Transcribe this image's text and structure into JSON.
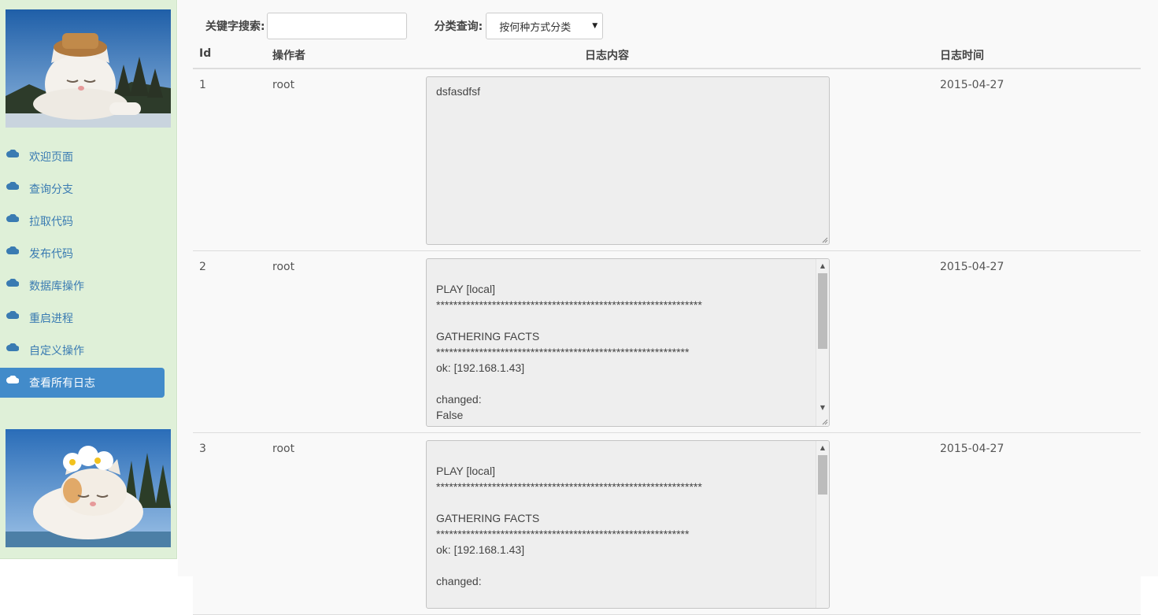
{
  "sidebar": {
    "items": [
      {
        "label": "欢迎页面",
        "icon": "cloud-icon",
        "active": false
      },
      {
        "label": "查询分支",
        "icon": "cloud-icon",
        "active": false
      },
      {
        "label": "拉取代码",
        "icon": "cloud-icon",
        "active": false
      },
      {
        "label": "发布代码",
        "icon": "cloud-icon",
        "active": false
      },
      {
        "label": "数据库操作",
        "icon": "cloud-icon",
        "active": false
      },
      {
        "label": "重启进程",
        "icon": "cloud-icon",
        "active": false
      },
      {
        "label": "自定义操作",
        "icon": "cloud-icon",
        "active": false
      },
      {
        "label": "查看所有日志",
        "icon": "cloud-icon",
        "active": true
      }
    ]
  },
  "search": {
    "keyword_label": "关键字搜索:",
    "keyword_value": "",
    "category_label": "分类查询:",
    "category_selected": "按何种方式分类"
  },
  "table": {
    "headers": {
      "id": "Id",
      "operator": "操作者",
      "content": "日志内容",
      "time": "日志时间"
    },
    "rows": [
      {
        "id": "1",
        "operator": "root",
        "content": "dsfasdfsf",
        "time": "2015-04-27"
      },
      {
        "id": "2",
        "operator": "root",
        "content": "\nPLAY [local]\n**************************************************************\n\nGATHERING FACTS\n***********************************************************\nok: [192.168.1.43]\n\nchanged:\nFalse",
        "time": "2015-04-27"
      },
      {
        "id": "3",
        "operator": "root",
        "content": "\nPLAY [local]\n**************************************************************\n\nGATHERING FACTS\n***********************************************************\nok: [192.168.1.43]\n\nchanged:",
        "time": "2015-04-27"
      }
    ]
  },
  "colors": {
    "sidebar_bg": "#dff0d8",
    "menu_text": "#3a7bb2",
    "active_bg": "#428bca"
  }
}
